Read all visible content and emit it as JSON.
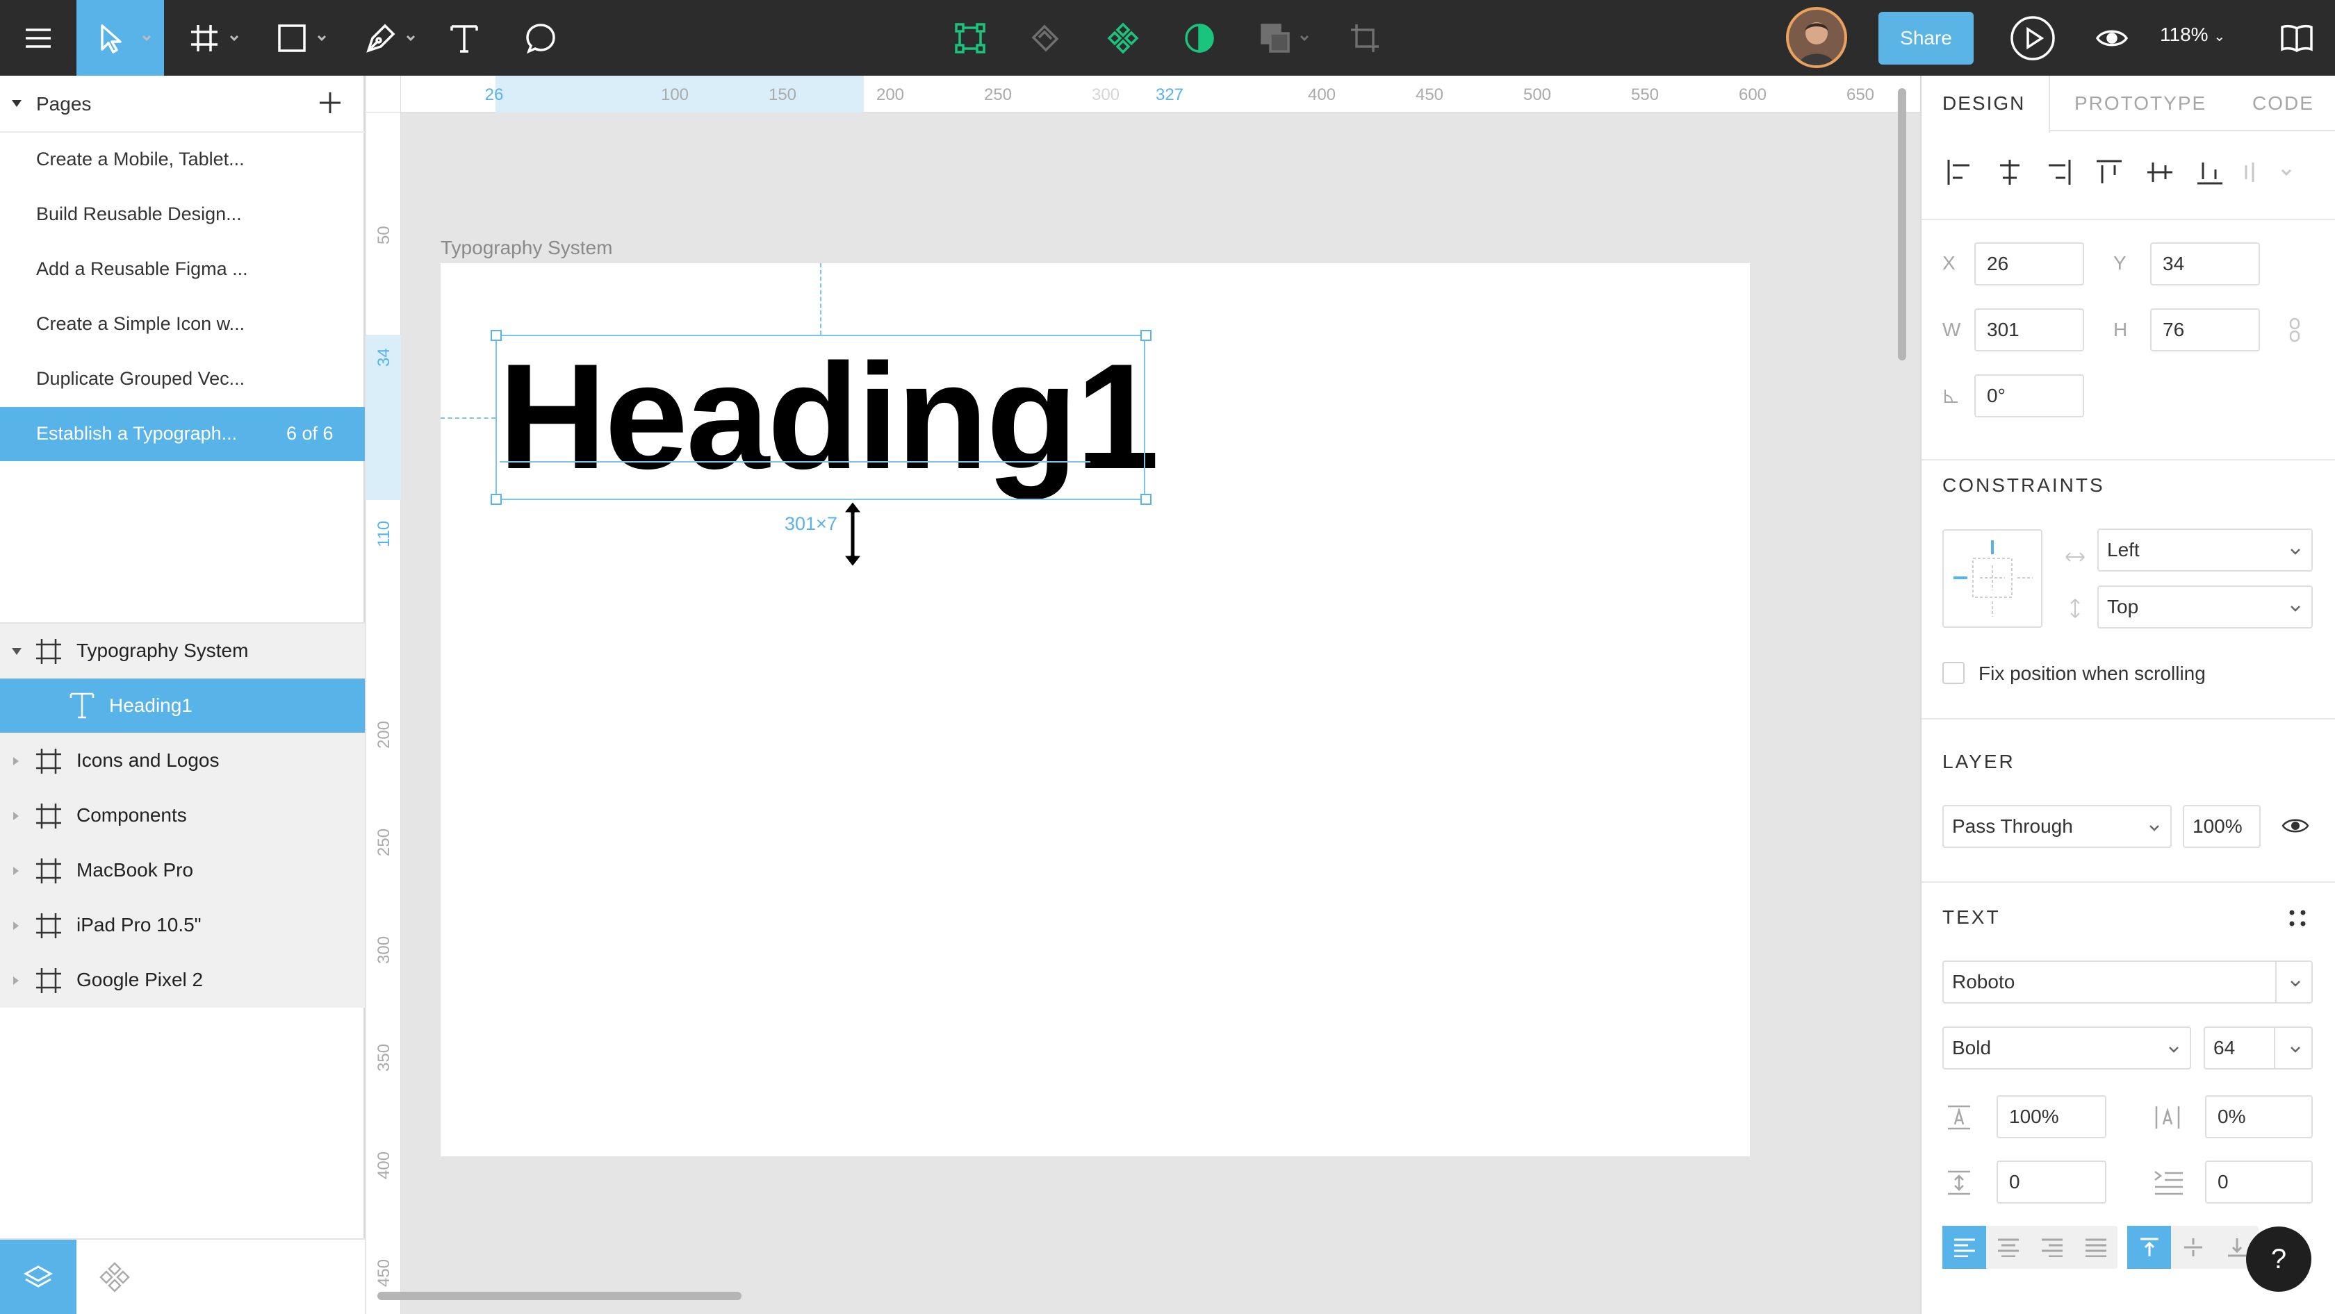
{
  "toolbar": {
    "share_label": "Share",
    "zoom_label": "118%",
    "tools": [
      "menu-icon",
      "move-tool-icon",
      "frame-tool-icon",
      "rectangle-tool-icon",
      "pen-tool-icon",
      "text-tool-icon",
      "comment-tool-icon"
    ],
    "center_tools": [
      "edit-vector-icon",
      "boolean-icon",
      "component-icon",
      "mask-icon",
      "boolean-group-icon",
      "crop-icon"
    ]
  },
  "pages": {
    "header": "Pages",
    "items": [
      {
        "label": "Create a Mobile, Tablet..."
      },
      {
        "label": "Build Reusable Design..."
      },
      {
        "label": "Add a Reusable Figma ..."
      },
      {
        "label": "Create a Simple Icon w..."
      },
      {
        "label": "Duplicate Grouped Vec..."
      },
      {
        "label": "Establish a Typograph...",
        "count": "6 of 6",
        "active": true
      }
    ]
  },
  "layers": [
    {
      "label": "Typography System",
      "expanded": true
    },
    {
      "label": "Heading1",
      "child": true,
      "selected": true
    },
    {
      "label": "Icons and Logos"
    },
    {
      "label": "Components"
    },
    {
      "label": "MacBook Pro"
    },
    {
      "label": "iPad Pro 10.5\""
    },
    {
      "label": "Google Pixel 2"
    }
  ],
  "canvas": {
    "frame_name": "Typography System",
    "text_content": "Heading1",
    "size_label": "301×7",
    "h_ruler": [
      "26",
      "100",
      "150",
      "200",
      "250",
      "300",
      "327",
      "400",
      "450",
      "500",
      "550",
      "600",
      "650"
    ],
    "v_ruler": [
      "50",
      "34",
      "110",
      "200",
      "250",
      "300",
      "350",
      "400",
      "450"
    ]
  },
  "design_panel": {
    "tabs": [
      "DESIGN",
      "PROTOTYPE",
      "CODE"
    ],
    "x": "26",
    "y": "34",
    "w": "301",
    "h": "76",
    "rotation": "0°",
    "labels": {
      "x": "X",
      "y": "Y",
      "w": "W",
      "h": "H"
    },
    "constraints_title": "CONSTRAINTS",
    "constraint_h": "Left",
    "constraint_v": "Top",
    "fix_position_label": "Fix position when scrolling",
    "layer_title": "LAYER",
    "blend_mode": "Pass Through",
    "opacity": "100%",
    "text_title": "TEXT",
    "font_family": "Roboto",
    "font_weight": "Bold",
    "font_size": "64",
    "line_height": "100%",
    "letter_spacing": "0%",
    "paragraph_spacing": "0",
    "paragraph_indent": "0"
  },
  "help_label": "?",
  "colors": {
    "accent": "#58b3e8",
    "toolbar": "#2c2c2c",
    "share": "#5ab4e6",
    "component_green": "#1bc47d"
  }
}
